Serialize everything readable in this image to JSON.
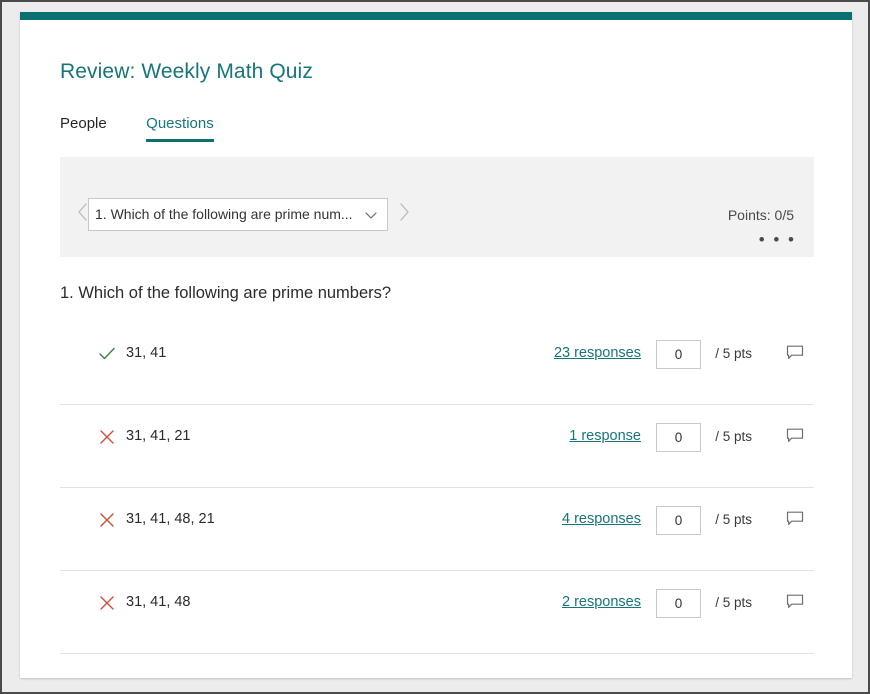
{
  "window": {
    "accent_color": "#0a7070",
    "background_color": "#ececec",
    "card_color": "#ffffff"
  },
  "header": {
    "title": "Review: Weekly Math Quiz",
    "title_color": "#17757b"
  },
  "tabs": [
    {
      "label": "People",
      "active": false,
      "name": "tab-people"
    },
    {
      "label": "Questions",
      "active": true,
      "name": "tab-questions"
    }
  ],
  "question_nav": {
    "prev_icon": "chevron-left-icon",
    "next_icon": "chevron-right-icon",
    "select_value": "1. Which of the following are prime num...",
    "select_chevron_icon": "chevron-down-icon",
    "points_label": "Points: 0/5",
    "more_menu_label": "• • •",
    "more_menu_icon": "ellipsis-icon"
  },
  "question": {
    "heading": "1. Which of the following are prime numbers?",
    "max_points": 5
  },
  "answer_options": [
    {
      "text": "31, 41",
      "status": "correct",
      "status_icon": "check-icon",
      "responses_label": "23 responses",
      "response_count": 23,
      "score_value": "0",
      "score_max_label": "/ 5 pts",
      "comment_icon": "comment-bubble-icon"
    },
    {
      "text": "31, 41, 21",
      "status": "incorrect",
      "status_icon": "close-x-icon",
      "responses_label": "1 response",
      "response_count": 1,
      "score_value": "0",
      "score_max_label": "/ 5 pts",
      "comment_icon": "comment-bubble-icon"
    },
    {
      "text": "31, 41, 48, 21",
      "status": "incorrect",
      "status_icon": "close-x-icon",
      "responses_label": "4 responses",
      "response_count": 4,
      "score_value": "0",
      "score_max_label": "/ 5 pts",
      "comment_icon": "comment-bubble-icon"
    },
    {
      "text": "31, 41, 48",
      "status": "incorrect",
      "status_icon": "close-x-icon",
      "responses_label": "2 responses",
      "response_count": 2,
      "score_value": "0",
      "score_max_label": "/ 5 pts",
      "comment_icon": "comment-bubble-icon"
    }
  ],
  "colors": {
    "teal_accent": "#0a7070",
    "teal_link": "#17757b",
    "correct_green": "#39823e",
    "incorrect_red": "#c94f3d",
    "panel_gray": "#f2f2f2",
    "divider_gray": "#e2e2e2"
  }
}
